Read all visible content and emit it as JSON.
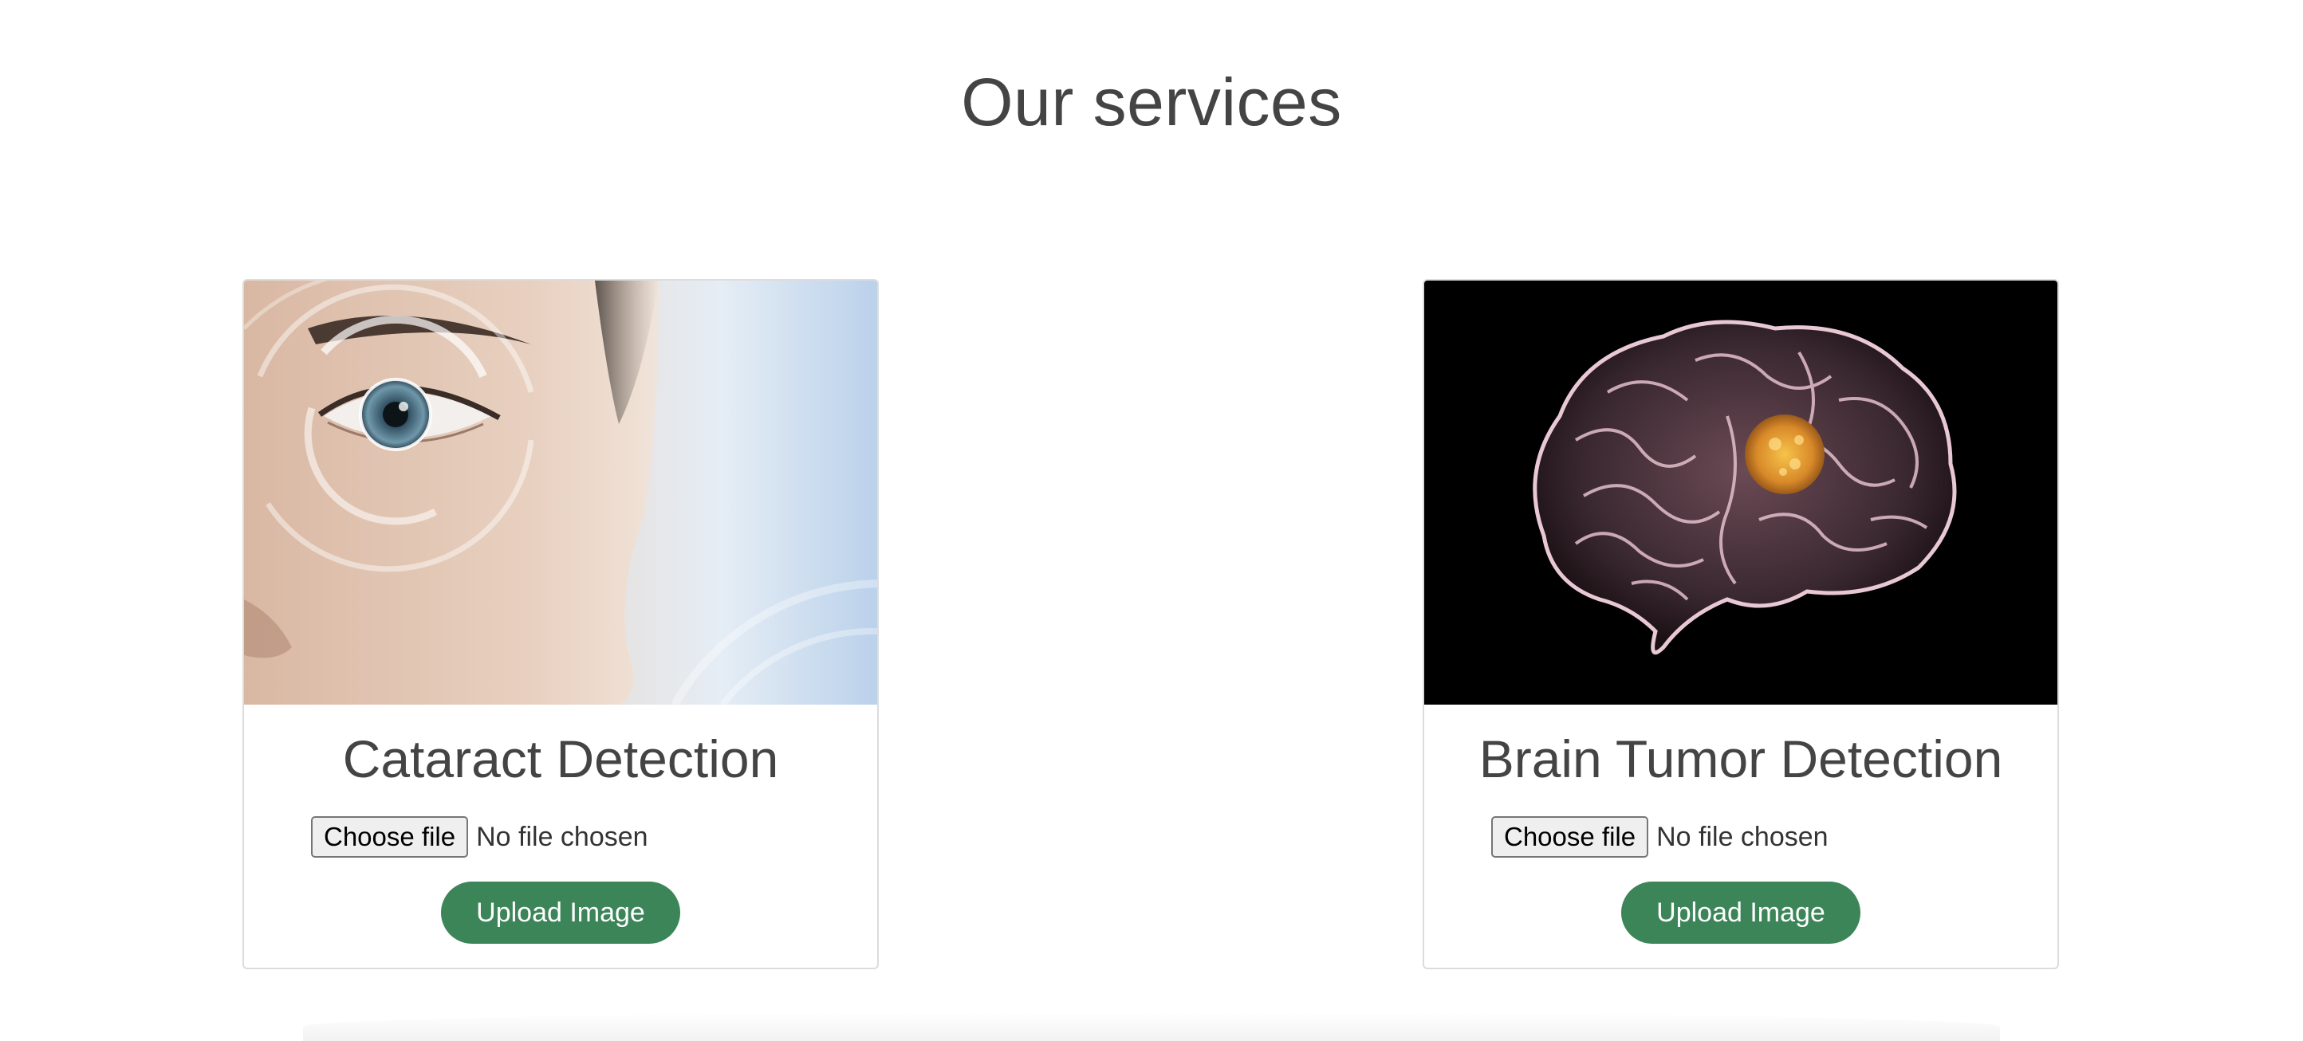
{
  "section": {
    "title": "Our services"
  },
  "services": [
    {
      "title": "Cataract Detection",
      "image_label": "eye-photo",
      "file_input": {
        "button_label": "Choose file",
        "status": "No file chosen"
      },
      "upload_label": "Upload Image"
    },
    {
      "title": "Brain Tumor Detection",
      "image_label": "brain-photo",
      "file_input": {
        "button_label": "Choose file",
        "status": "No file chosen"
      },
      "upload_label": "Upload Image"
    }
  ],
  "colors": {
    "upload_button": "#3b8558",
    "heading_text": "#444444",
    "card_border": "#dcdcdc"
  }
}
